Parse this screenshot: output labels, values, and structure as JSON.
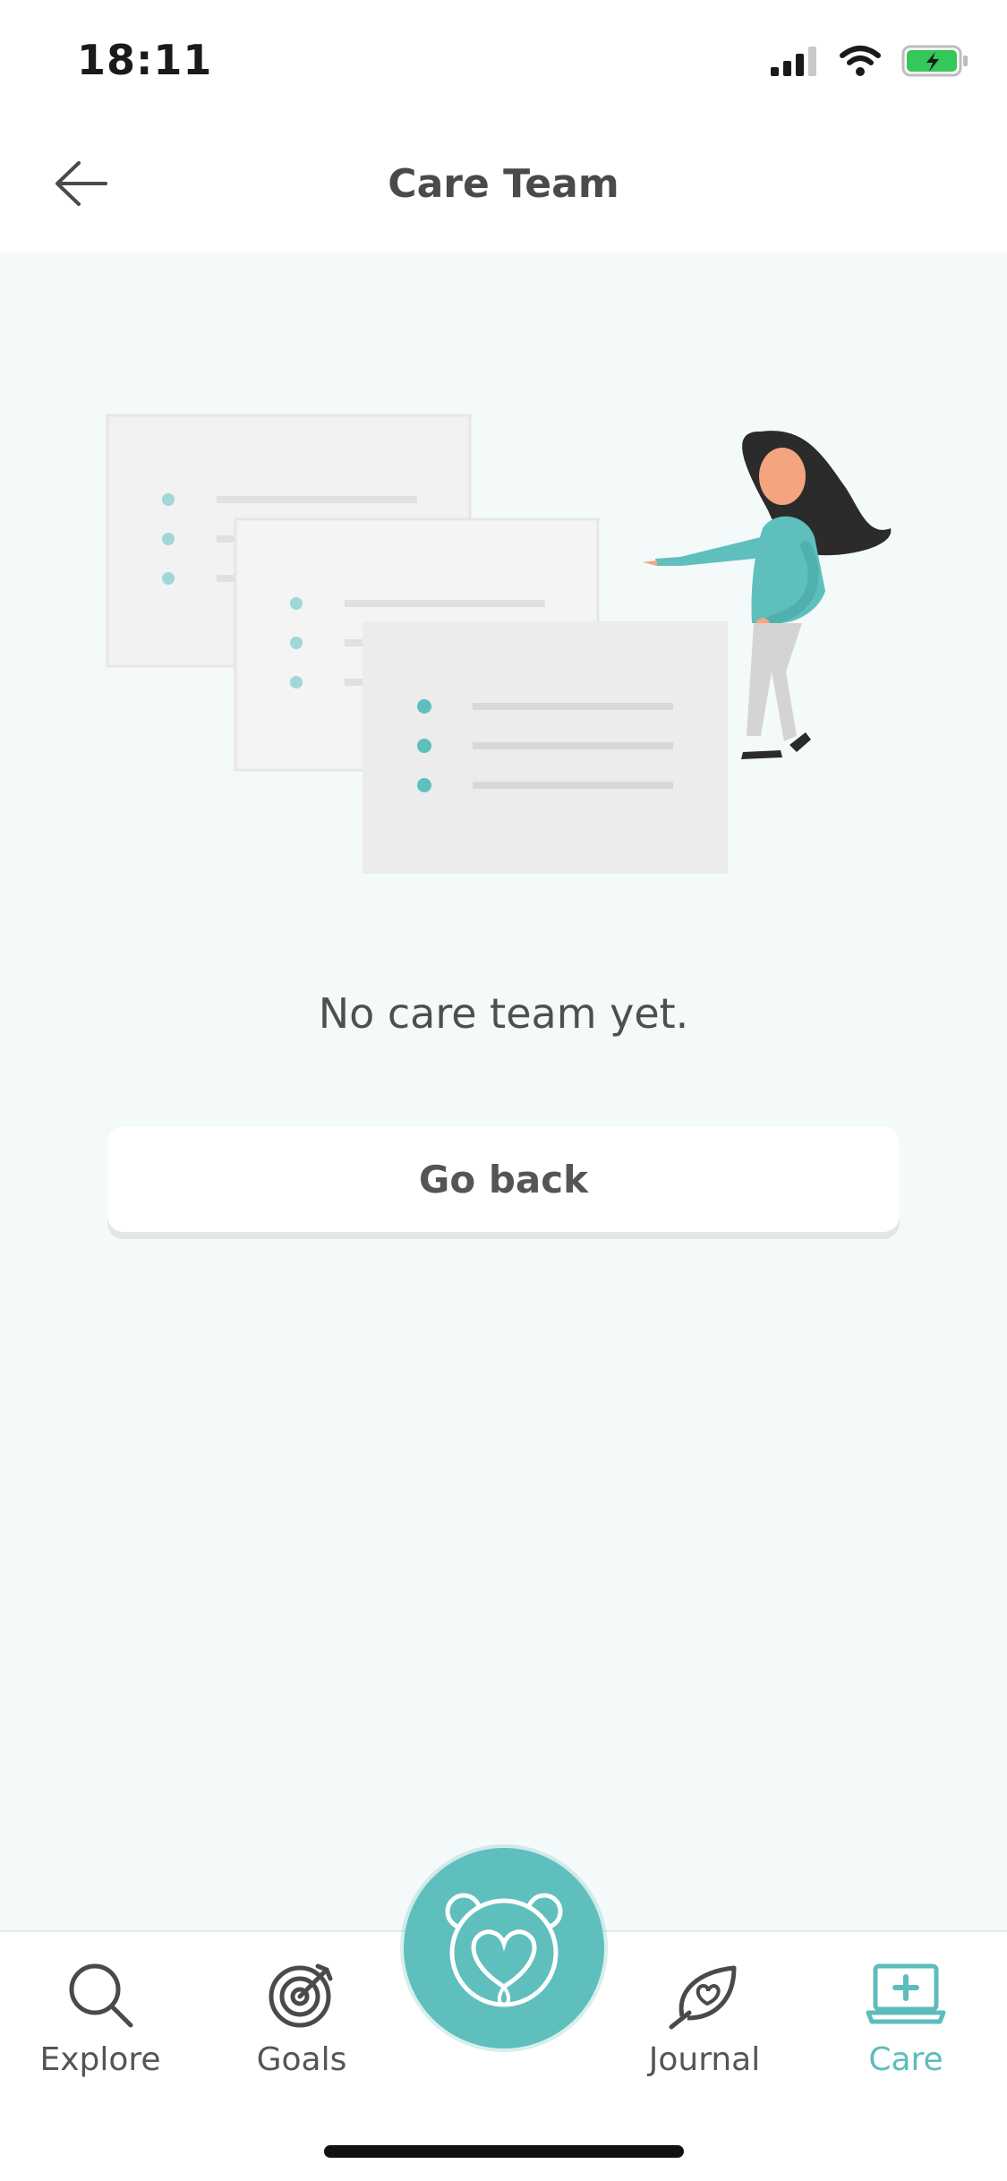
{
  "status_bar": {
    "time": "18:11"
  },
  "header": {
    "title": "Care Team"
  },
  "empty_state": {
    "message": "No care team yet."
  },
  "actions": {
    "go_back_label": "Go back"
  },
  "tabbar": {
    "tabs": [
      {
        "label": "Explore",
        "icon": "search-icon",
        "active": false
      },
      {
        "label": "Goals",
        "icon": "target-icon",
        "active": false
      },
      {
        "label": "Journal",
        "icon": "leaf-heart-icon",
        "active": false
      },
      {
        "label": "Care",
        "icon": "laptop-medical-icon",
        "active": true
      }
    ],
    "center_icon": "bear-heart-icon"
  },
  "colors": {
    "accent": "#5fbfbd",
    "active_tab": "#5dbcbc",
    "background": "#f4f9f9",
    "text": "#555555"
  }
}
